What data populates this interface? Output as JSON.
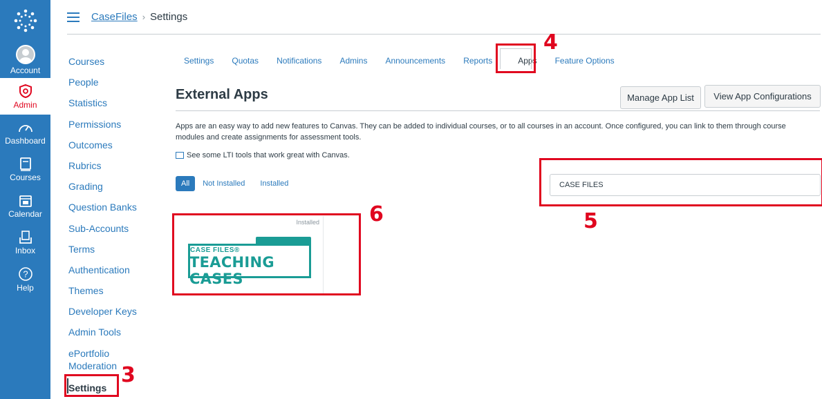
{
  "global_nav": {
    "items": [
      {
        "label": "Account",
        "icon": "avatar-icon"
      },
      {
        "label": "Admin",
        "icon": "shield-icon"
      },
      {
        "label": "Dashboard",
        "icon": "dashboard-icon"
      },
      {
        "label": "Courses",
        "icon": "book-icon"
      },
      {
        "label": "Calendar",
        "icon": "calendar-icon"
      },
      {
        "label": "Inbox",
        "icon": "inbox-icon"
      },
      {
        "label": "Help",
        "icon": "help-icon"
      }
    ]
  },
  "breadcrumb": {
    "root": "CaseFiles",
    "separator": "›",
    "current": "Settings"
  },
  "account_nav": {
    "items": [
      "Courses",
      "People",
      "Statistics",
      "Permissions",
      "Outcomes",
      "Rubrics",
      "Grading",
      "Question Banks",
      "Sub-Accounts",
      "Terms",
      "Authentication",
      "Themes",
      "Developer Keys",
      "Admin Tools",
      "ePortfolio Moderation",
      "Settings"
    ]
  },
  "tabs": [
    "Settings",
    "Quotas",
    "Notifications",
    "Admins",
    "Announcements",
    "Reports",
    "Apps",
    "Feature Options"
  ],
  "page": {
    "title": "External Apps",
    "manage_button": "Manage App List",
    "view_button": "View App Configurations",
    "description": "Apps are an easy way to add new features to Canvas. They can be added to individual courses, or to all courses in an account. Once configured, you can link to them through course modules and create assignments for assessment tools.",
    "lti_link": "See some LTI tools that work great with Canvas."
  },
  "filters": {
    "all": "All",
    "not_installed": "Not Installed",
    "installed": "Installed"
  },
  "search": {
    "value": "CASE FILES"
  },
  "app_card": {
    "status": "Installed",
    "logo_line1": "CASE FILES®",
    "logo_line2": "TEACHING CASES"
  },
  "annotations": {
    "n3": "3",
    "n4": "4",
    "n5": "5",
    "n6": "6"
  },
  "colors": {
    "brand": "#2b7abc",
    "highlight": "#e0061f",
    "logo": "#1a9c95"
  }
}
